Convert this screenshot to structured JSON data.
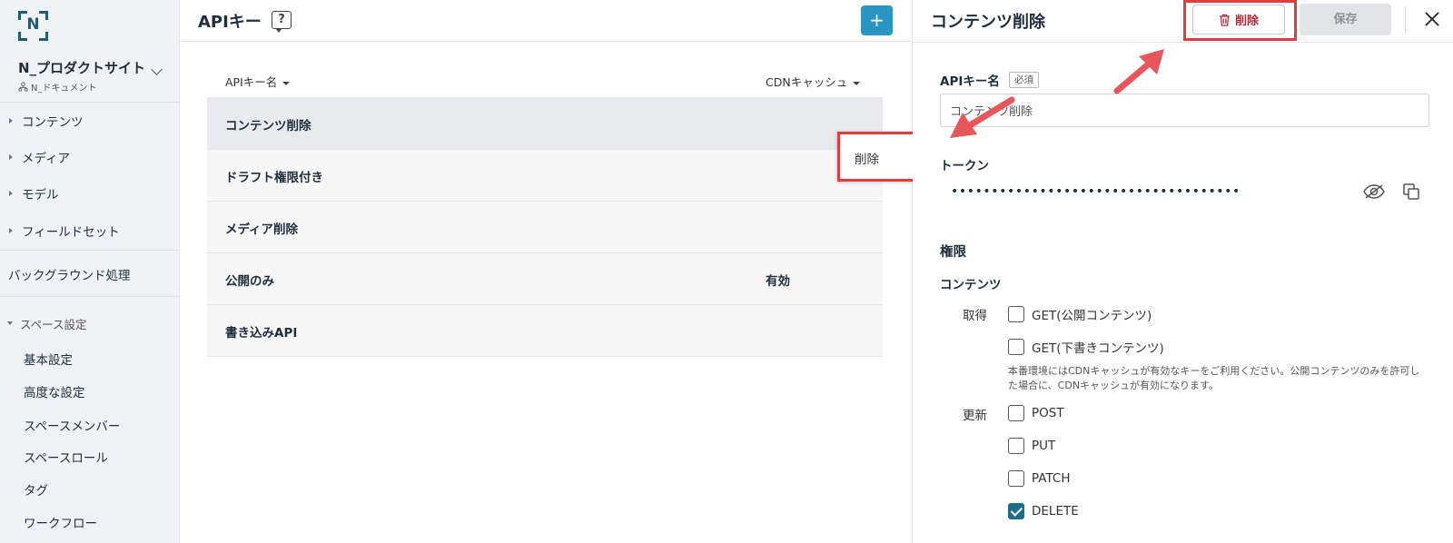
{
  "sidebar": {
    "logo_letter": "N",
    "site_name": "N_プロダクトサイト",
    "site_org": "N_ドキュメント",
    "items": [
      {
        "label": "コンテンツ"
      },
      {
        "label": "メディア"
      },
      {
        "label": "モデル"
      },
      {
        "label": "フィールドセット"
      }
    ],
    "background_jobs": "バックグラウンド処理",
    "space_settings": "スペース設定",
    "sub_items": [
      {
        "label": "基本設定"
      },
      {
        "label": "高度な設定"
      },
      {
        "label": "スペースメンバー"
      },
      {
        "label": "スペースロール"
      },
      {
        "label": "タグ"
      },
      {
        "label": "ワークフロー"
      }
    ]
  },
  "main": {
    "title": "APIキー",
    "add_label": "+",
    "columns": {
      "name": "APIキー名",
      "cdn": "CDNキャッシュ"
    },
    "rows": [
      {
        "name": "コンテンツ削除",
        "cdn": ""
      },
      {
        "name": "ドラフト権限付き",
        "cdn": ""
      },
      {
        "name": "メディア削除",
        "cdn": ""
      },
      {
        "name": "公開のみ",
        "cdn": "有効"
      },
      {
        "name": "書き込みAPI",
        "cdn": ""
      }
    ]
  },
  "context_menu": {
    "delete": "削除"
  },
  "detail": {
    "title": "コンテンツ削除",
    "delete_label": "削除",
    "save_label": "保存",
    "name_label": "APIキー名",
    "required": "必須",
    "name_value": "コンテンツ削除",
    "token_label": "トークン",
    "token_masked": "••••••••••••••••••••••••••••••••••••",
    "permissions_title": "権限",
    "content_title": "コンテンツ",
    "get_label": "取得",
    "update_label": "更新",
    "get_public": "GET(公開コンテンツ)",
    "get_draft": "GET(下書きコンテンツ)",
    "note": "本番環境にはCDNキャッシュが有効なキーをご利用ください。公開コンテンツのみを許可した場合に、CDNキャッシュが有効になります。",
    "post": "POST",
    "put": "PUT",
    "patch": "PATCH",
    "delete": "DELETE"
  },
  "colors": {
    "accent": "#2a94c2",
    "highlight": "#e23d3d",
    "danger": "#c0283a",
    "checked": "#1d6d8a"
  }
}
